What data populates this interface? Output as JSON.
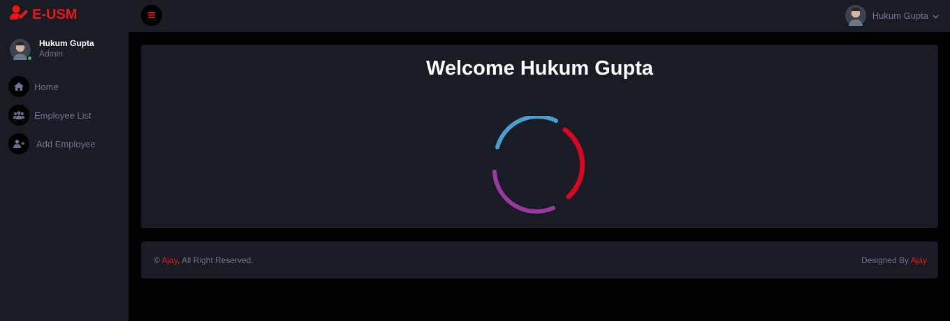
{
  "brand": {
    "name": "E-USM",
    "color": "#eb1616",
    "icon": "user-edit-icon"
  },
  "sidebar": {
    "user": {
      "name": "Hukum Gupta",
      "role": "Admin",
      "status": "online"
    },
    "items": [
      {
        "label": "Home",
        "icon": "home-icon"
      },
      {
        "label": "Employee List",
        "icon": "users-icon"
      },
      {
        "label": "Add Employee",
        "icon": "user-plus-icon"
      }
    ]
  },
  "topbar": {
    "toggle_icon": "bars-icon",
    "user_name": "Hukum Gupta",
    "dropdown_icon": "chevron-down-icon"
  },
  "main": {
    "welcome": "Welcome Hukum Gupta"
  },
  "footer": {
    "copyright_symbol": "©",
    "left_link": "Ajay",
    "left_text": ", All Right Reserved.",
    "right_prefix": "Designed By ",
    "right_link": "Ajay"
  },
  "colors": {
    "background": "#000000",
    "panel": "#191c24",
    "muted_text": "#6c7293",
    "accent": "#eb1616"
  }
}
